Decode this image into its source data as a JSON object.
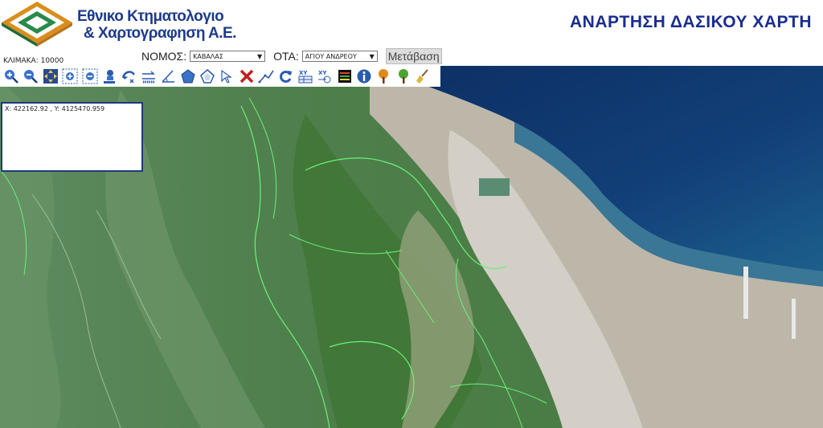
{
  "header": {
    "org_line1": "Εθνικο Κτηματολογιο",
    "org_line2": "& Χαρτογραφηση Α.Ε.",
    "page_title": "ΑΝΑΡΤΗΣΗ ΔΑΣΙΚΟΥ ΧΑΡΤΗ",
    "title_color": "#1a2d8f"
  },
  "scale": {
    "label": "ΚΛΙΜΑΚΑ: 10000"
  },
  "filters": {
    "nomos_label": "ΝΟΜΟΣ:",
    "nomos_value": "ΚΑΒΑΛΑΣ",
    "ota_label": "ΟΤΑ:",
    "ota_value": "ΑΓΙΟΥ ΑΝΔΡΕΟΥ",
    "go_label": "Μετάβαση"
  },
  "toolbar": {
    "tools": [
      "zoom-in-icon",
      "zoom-out-icon",
      "pan-icon",
      "zoom-box-in-icon",
      "zoom-box-out-icon",
      "previous-extent-icon",
      "next-extent-icon",
      "measure-distance-icon",
      "measure-angle-icon",
      "draw-polygon-icon",
      "draw-star-icon",
      "select-pointer-icon",
      "clear-icon",
      "draw-line-icon",
      "refresh-icon",
      "xy-table-icon",
      "xy-goto-icon",
      "layers-icon",
      "info-icon",
      "tree-orange-icon",
      "tree-green-icon",
      "broom-icon"
    ]
  },
  "coordinates": {
    "text": "X: 422162.92 , Y: 4125470.959"
  },
  "colors": {
    "sea_deep": "#0f3468",
    "sea_shallow": "#2a6a8e",
    "forest": "#3f7a3a",
    "boundary": "#6bf07a",
    "town": "#c9c2b6"
  }
}
